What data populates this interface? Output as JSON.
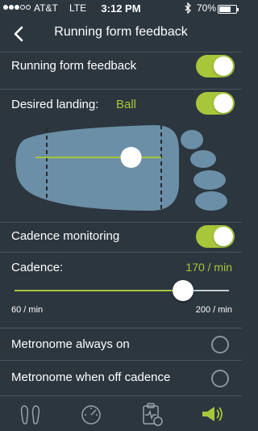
{
  "status_bar": {
    "carrier": "AT&T",
    "network": "LTE",
    "time": "3:12 PM",
    "battery": "70%",
    "battery_level": 0.7
  },
  "nav": {
    "title": "Running form feedback",
    "back_icon": "chevron-left-icon"
  },
  "settings": {
    "form_feedback": {
      "label": "Running form feedback",
      "enabled": true
    },
    "desired_landing": {
      "label": "Desired landing:",
      "value": "Ball",
      "enabled": true,
      "position": 0.76
    },
    "cadence_monitoring": {
      "label": "Cadence monitoring",
      "enabled": true
    },
    "cadence": {
      "label": "Cadence:",
      "value": "170 / min",
      "min_label": "60 / min",
      "max_label": "200 / min",
      "min": 60,
      "max": 200,
      "current": 170
    },
    "metronome_always": {
      "label": "Metronome always on",
      "selected": false
    },
    "metronome_off_cadence": {
      "label": "Metronome when off cadence",
      "selected": false
    }
  },
  "tabs": [
    {
      "name": "footprints-icon",
      "active": false
    },
    {
      "name": "speedometer-icon",
      "active": false
    },
    {
      "name": "clipboard-heartrate-icon",
      "active": false
    },
    {
      "name": "megaphone-icon",
      "active": true
    }
  ],
  "colors": {
    "accent": "#a7c63a",
    "background": "#2c363f",
    "foot": "#6b8fa6"
  }
}
